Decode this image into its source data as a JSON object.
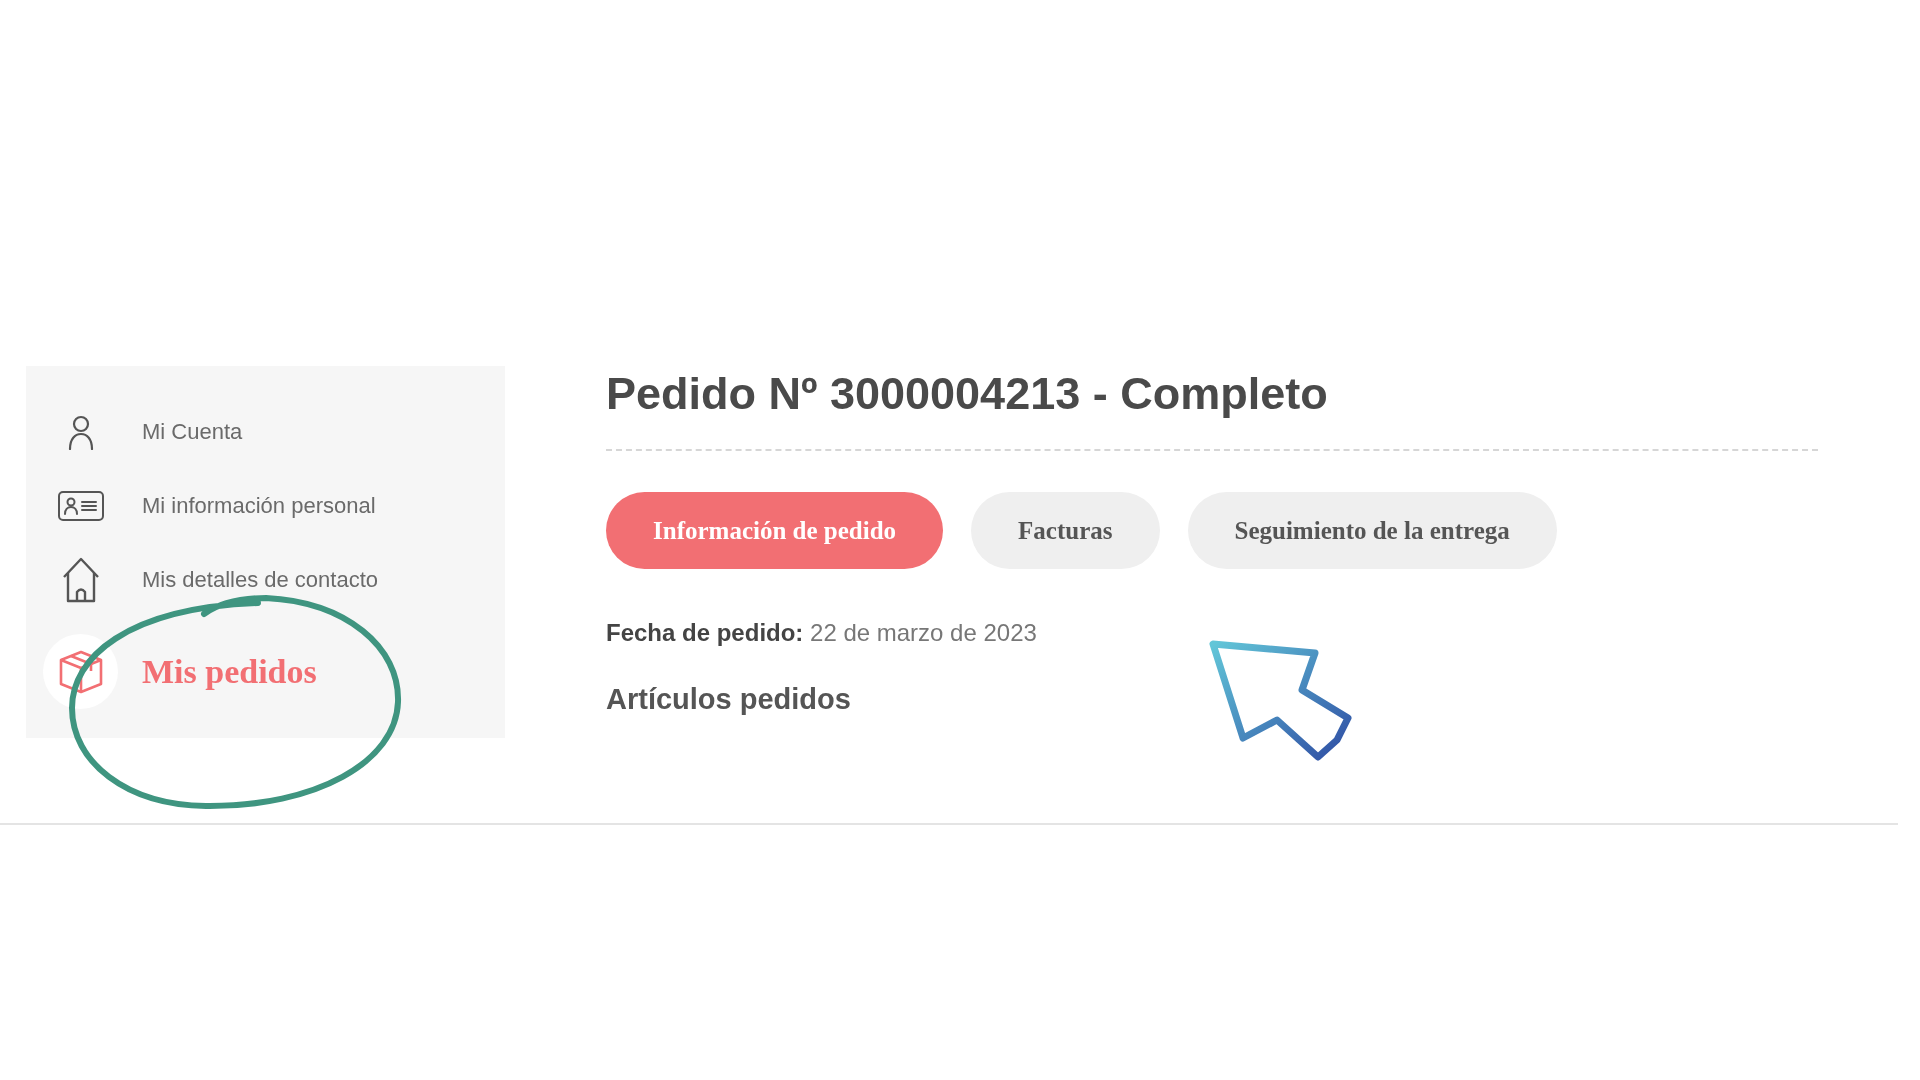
{
  "sidebar": {
    "items": [
      {
        "label": "Mi Cuenta",
        "selected": false
      },
      {
        "label": "Mi información personal",
        "selected": false
      },
      {
        "label": "Mis detalles de contacto",
        "selected": false
      },
      {
        "label": "Mis pedidos",
        "selected": true
      }
    ]
  },
  "order": {
    "title": "Pedido Nº 3000004213 - Completo",
    "tabs": [
      {
        "label": "Información de pedido",
        "selected": true
      },
      {
        "label": "Facturas",
        "selected": false
      },
      {
        "label": "Seguimiento de la entrega",
        "selected": false
      }
    ],
    "date": {
      "label": "Fecha de pedido:",
      "value": "22 de marzo de 2023"
    },
    "items_heading": "Artículos pedidos"
  }
}
